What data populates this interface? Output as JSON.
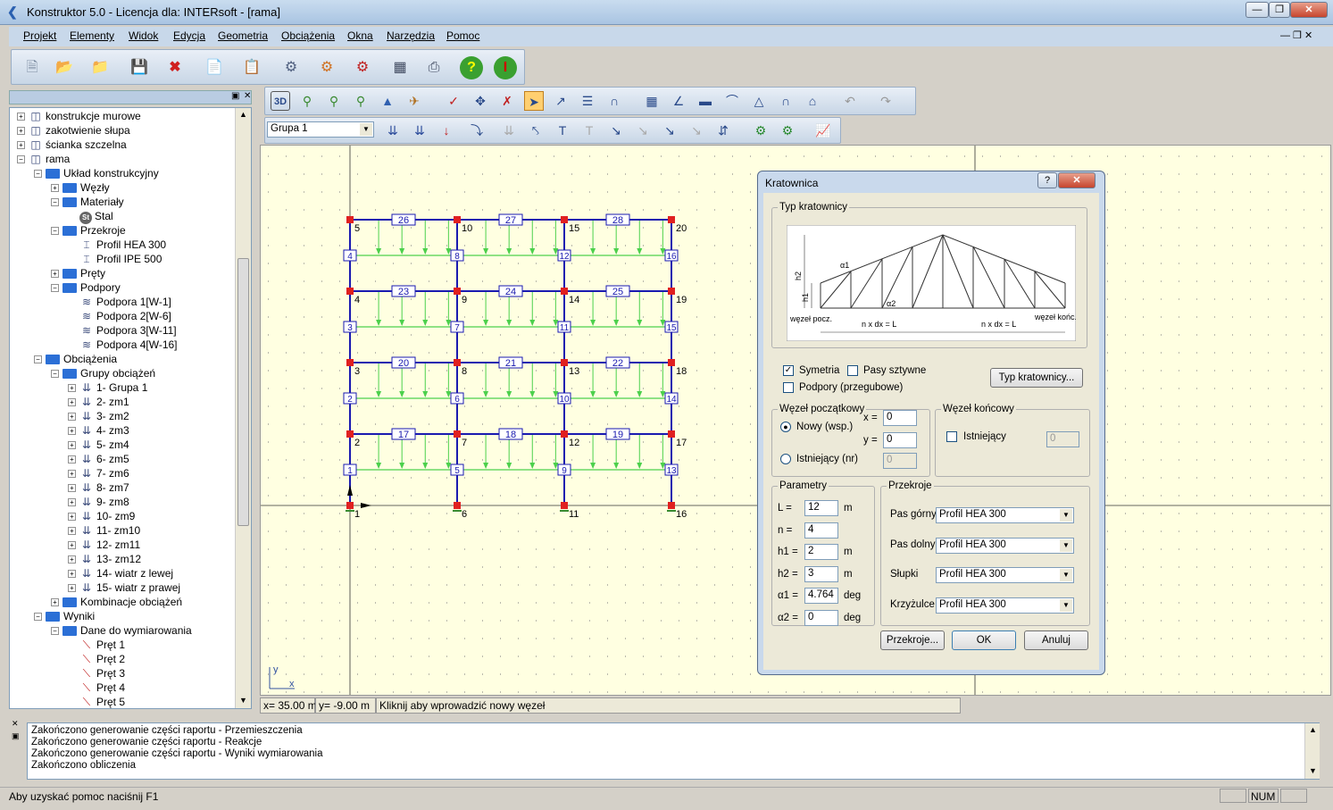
{
  "window": {
    "title": "Konstruktor 5.0 - Licencja dla: INTERsoft - [rama]"
  },
  "menu": [
    "Projekt",
    "Elementy",
    "Widok",
    "Edycja",
    "Geometria",
    "Obciążenia",
    "Okna",
    "Narzędzia",
    "Pomoc"
  ],
  "toolbar": {
    "group_select": "Grupa 1"
  },
  "tree": [
    {
      "label": "konstrukcje murowe",
      "level": 0,
      "exp": "+",
      "icon": "struct"
    },
    {
      "label": "zakotwienie słupa",
      "level": 0,
      "exp": "+",
      "icon": "struct"
    },
    {
      "label": "ścianka szczelna",
      "level": 0,
      "exp": "+",
      "icon": "struct"
    },
    {
      "label": "rama",
      "level": 0,
      "exp": "-",
      "icon": "struct"
    },
    {
      "label": "Układ konstrukcyjny",
      "level": 1,
      "exp": "-",
      "icon": "folder"
    },
    {
      "label": "Węzły",
      "level": 2,
      "exp": "+",
      "icon": "folder"
    },
    {
      "label": "Materiały",
      "level": 2,
      "exp": "-",
      "icon": "folder"
    },
    {
      "label": "Stal",
      "level": 3,
      "exp": "",
      "icon": "st"
    },
    {
      "label": "Przekroje",
      "level": 2,
      "exp": "-",
      "icon": "folder"
    },
    {
      "label": "Profil HEA 300",
      "level": 3,
      "exp": "",
      "icon": "prof"
    },
    {
      "label": "Profil IPE 500",
      "level": 3,
      "exp": "",
      "icon": "prof"
    },
    {
      "label": "Pręty",
      "level": 2,
      "exp": "+",
      "icon": "folder"
    },
    {
      "label": "Podpory",
      "level": 2,
      "exp": "-",
      "icon": "folder"
    },
    {
      "label": "Podpora 1[W-1]",
      "level": 3,
      "exp": "",
      "icon": "sup"
    },
    {
      "label": "Podpora 2[W-6]",
      "level": 3,
      "exp": "",
      "icon": "sup"
    },
    {
      "label": "Podpora 3[W-11]",
      "level": 3,
      "exp": "",
      "icon": "sup"
    },
    {
      "label": "Podpora 4[W-16]",
      "level": 3,
      "exp": "",
      "icon": "sup"
    },
    {
      "label": "Obciążenia",
      "level": 1,
      "exp": "-",
      "icon": "folder"
    },
    {
      "label": "Grupy obciążeń",
      "level": 2,
      "exp": "-",
      "icon": "folder"
    },
    {
      "label": "1- Grupa 1",
      "level": 3,
      "exp": "+",
      "icon": "load"
    },
    {
      "label": "2- zm1",
      "level": 3,
      "exp": "+",
      "icon": "load"
    },
    {
      "label": "3- zm2",
      "level": 3,
      "exp": "+",
      "icon": "load"
    },
    {
      "label": "4- zm3",
      "level": 3,
      "exp": "+",
      "icon": "load"
    },
    {
      "label": "5- zm4",
      "level": 3,
      "exp": "+",
      "icon": "load"
    },
    {
      "label": "6- zm5",
      "level": 3,
      "exp": "+",
      "icon": "load"
    },
    {
      "label": "7- zm6",
      "level": 3,
      "exp": "+",
      "icon": "load"
    },
    {
      "label": "8- zm7",
      "level": 3,
      "exp": "+",
      "icon": "load"
    },
    {
      "label": "9- zm8",
      "level": 3,
      "exp": "+",
      "icon": "load"
    },
    {
      "label": "10- zm9",
      "level": 3,
      "exp": "+",
      "icon": "load"
    },
    {
      "label": "11- zm10",
      "level": 3,
      "exp": "+",
      "icon": "load"
    },
    {
      "label": "12- zm11",
      "level": 3,
      "exp": "+",
      "icon": "load"
    },
    {
      "label": "13- zm12",
      "level": 3,
      "exp": "+",
      "icon": "load"
    },
    {
      "label": "14- wiatr z lewej",
      "level": 3,
      "exp": "+",
      "icon": "load"
    },
    {
      "label": "15- wiatr z prawej",
      "level": 3,
      "exp": "+",
      "icon": "load"
    },
    {
      "label": "Kombinacje obciążeń",
      "level": 2,
      "exp": "+",
      "icon": "folder"
    },
    {
      "label": "Wyniki",
      "level": 1,
      "exp": "-",
      "icon": "folder"
    },
    {
      "label": "Dane do wymiarowania",
      "level": 2,
      "exp": "-",
      "icon": "folder"
    },
    {
      "label": "Pręt 1",
      "level": 3,
      "exp": "",
      "icon": "bar"
    },
    {
      "label": "Pręt 2",
      "level": 3,
      "exp": "",
      "icon": "bar"
    },
    {
      "label": "Pręt 3",
      "level": 3,
      "exp": "",
      "icon": "bar"
    },
    {
      "label": "Pręt 4",
      "level": 3,
      "exp": "",
      "icon": "bar"
    },
    {
      "label": "Pręt 5",
      "level": 3,
      "exp": "",
      "icon": "bar"
    }
  ],
  "frame": {
    "node_labels": [
      "1",
      "2",
      "3",
      "4",
      "5",
      "6",
      "7",
      "8",
      "9",
      "10",
      "11",
      "12",
      "13",
      "14",
      "15",
      "16",
      "17",
      "18",
      "19",
      "20"
    ],
    "beam_labels": [
      [
        "17",
        "18",
        "19"
      ],
      [
        "20",
        "21",
        "22"
      ],
      [
        "23",
        "24",
        "25"
      ],
      [
        "26",
        "27",
        "28"
      ]
    ],
    "column_labels": [
      [
        "1",
        "2",
        "3",
        "4"
      ],
      [
        "5",
        "6",
        "7",
        "8"
      ],
      [
        "9",
        "10",
        "11",
        "12"
      ],
      [
        "13",
        "14",
        "15",
        "16"
      ]
    ]
  },
  "dialog": {
    "title": "Kratownica",
    "type_group": "Typ kratownicy",
    "diagram": {
      "h2": "h2",
      "h1": "h1",
      "a1": "α1",
      "a2": "α2",
      "start": "węzeł pocz.",
      "end": "węzeł końc.",
      "span_left": "n x dx = L",
      "span_right": "n x dx = L"
    },
    "symetria": "Symetria",
    "pasy": "Pasy sztywne",
    "podpory": "Podpory (przegubowe)",
    "typ_btn": "Typ kratownicy...",
    "start_group": "Węzeł początkowy",
    "nowy": "Nowy (wsp.)",
    "istniejacy_nr": "Istniejący (nr)",
    "x_label": "x =",
    "y_label": "y =",
    "x_val": "0",
    "y_val": "0",
    "nr_val": "0",
    "end_group": "Węzeł końcowy",
    "istniejacy": "Istniejący",
    "end_val": "0",
    "param_group": "Parametry",
    "params": [
      {
        "label": "L =",
        "value": "12",
        "unit": "m"
      },
      {
        "label": "n =",
        "value": "4",
        "unit": ""
      },
      {
        "label": "h1 =",
        "value": "2",
        "unit": "m"
      },
      {
        "label": "h2 =",
        "value": "3",
        "unit": "m"
      },
      {
        "label": "α1 =",
        "value": "4.764",
        "unit": "deg"
      },
      {
        "label": "α2 =",
        "value": "0",
        "unit": "deg"
      }
    ],
    "sect_group": "Przekroje",
    "sections": [
      {
        "label": "Pas górny",
        "value": "Profil HEA 300"
      },
      {
        "label": "Pas dolny",
        "value": "Profil HEA 300"
      },
      {
        "label": "Słupki",
        "value": "Profil HEA 300"
      },
      {
        "label": "Krzyżulce",
        "value": "Profil HEA 300"
      }
    ],
    "btn_sect": "Przekroje...",
    "btn_ok": "OK",
    "btn_cancel": "Anuluj"
  },
  "status": {
    "x": "x= 35.00 m",
    "y": "y= -9.00 m",
    "hint": "Kliknij aby wprowadzić nowy węzeł"
  },
  "log": [
    "Zakończono generowanie części raportu - Przemieszczenia",
    "Zakończono generowanie części raportu - Reakcje",
    "Zakończono generowanie części raportu - Wyniki wymiarowania",
    "Zakończono obliczenia"
  ],
  "bottom": {
    "help": "Aby uzyskać pomoc naciśnij F1",
    "num": "NUM"
  }
}
